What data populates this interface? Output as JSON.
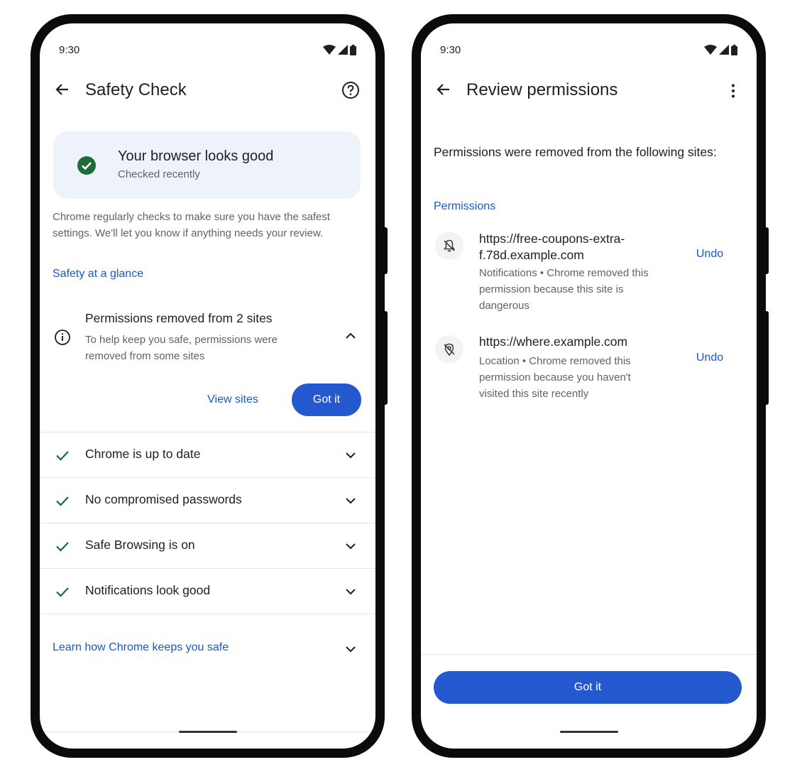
{
  "left_screen": {
    "status_bar": {
      "time": "9:30"
    },
    "appbar": {
      "title": "Safety Check"
    },
    "status_card": {
      "title": "Your browser looks good",
      "subtitle": "Checked recently"
    },
    "description": "Chrome regularly checks to make sure you have the safest settings. We'll let you know if anything needs your review.",
    "section_label": "Safety at a glance",
    "permissions_card": {
      "title": "Permissions removed from 2 sites",
      "subtitle": "To help keep you safe, permissions were removed from some sites",
      "view_sites_label": "View sites",
      "got_it_label": "Got it"
    },
    "checks": [
      {
        "label": "Chrome is up to date"
      },
      {
        "label": "No compromised passwords"
      },
      {
        "label": "Safe Browsing is on"
      },
      {
        "label": "Notifications look good"
      }
    ],
    "learn_more": "Learn how Chrome keeps you safe"
  },
  "right_screen": {
    "status_bar": {
      "time": "9:30"
    },
    "appbar": {
      "title": "Review permissions"
    },
    "intro": "Permissions were removed from the following sites:",
    "section_label": "Permissions",
    "sites": [
      {
        "url_line1": "https://free-coupons-extra-",
        "url_line2": "f.78d.example.com",
        "desc_line1": "Notifications • Chrome removed this",
        "desc_line2": "permission because this site is",
        "desc_line3": "dangerous",
        "undo_label": "Undo",
        "icon": "notifications-off-icon"
      },
      {
        "url_line1": "https://where.example.com",
        "desc_line1": "Location • Chrome removed this",
        "desc_line2": "permission because you haven't",
        "desc_line3": "visited this site recently",
        "undo_label": "Undo",
        "icon": "location-off-icon"
      }
    ],
    "got_it_label": "Got it"
  },
  "colors": {
    "accent": "#2458cf",
    "link": "#1a57c7",
    "success": "#1e6b3a",
    "card_bg": "#eef3fb"
  }
}
